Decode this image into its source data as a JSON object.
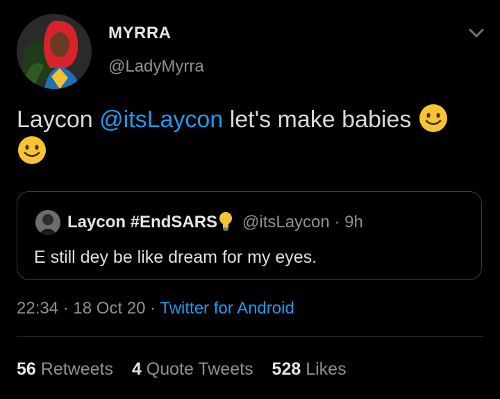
{
  "author": {
    "name": "MYRRA",
    "handle": "@LadyMyrra"
  },
  "tweet": {
    "text_before": "Laycon ",
    "mention": "@itsLaycon",
    "text_after": " let's make babies "
  },
  "quoted_tweet": {
    "name": "Laycon #EndSARS",
    "handle": "@itsLaycon",
    "separator": "·",
    "age": "9h",
    "text": "E still dey be like dream for my eyes."
  },
  "meta": {
    "time": "22:34",
    "dot": "·",
    "date": "18 Oct 20",
    "via": "Twitter for Android"
  },
  "stats": {
    "retweets_count": "56",
    "retweets_label": "Retweets",
    "quotes_count": "4",
    "quotes_label": "Quote Tweets",
    "likes_count": "528",
    "likes_label": "Likes"
  },
  "icons": {
    "menu": "chevron-down-icon",
    "emoji": "smiling-face-emoji",
    "bulb": "light-bulb-emoji"
  },
  "colors": {
    "background": "#000000",
    "link": "#1d9bf0",
    "secondary_text": "#8b9299",
    "border": "#3a3f44"
  }
}
